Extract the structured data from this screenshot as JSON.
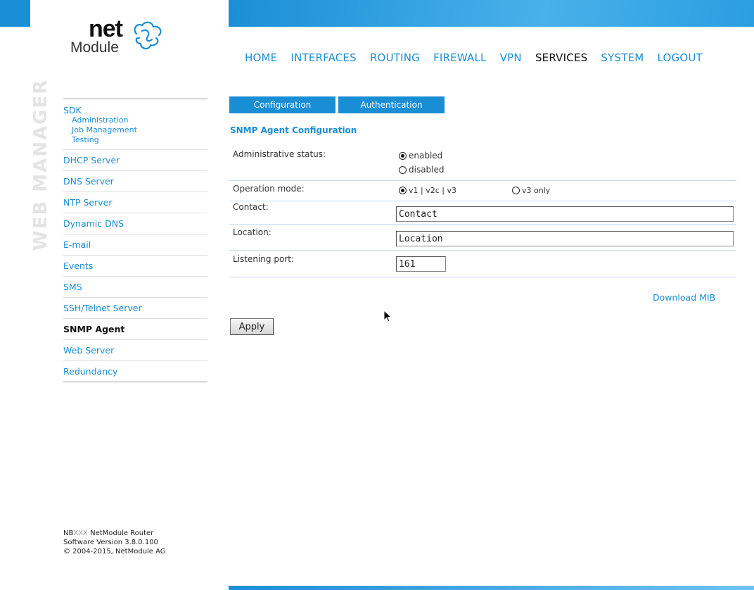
{
  "logo": {
    "net": "net",
    "module": "Module"
  },
  "nav": {
    "items": [
      "HOME",
      "INTERFACES",
      "ROUTING",
      "FIREWALL",
      "VPN",
      "SERVICES",
      "SYSTEM",
      "LOGOUT"
    ],
    "active": "SERVICES"
  },
  "vertical_title": "WEB MANAGER",
  "sidebar": {
    "sdk": {
      "label": "SDK",
      "subitems": [
        "Administration",
        "Job Management",
        "Testing"
      ]
    },
    "items": [
      "DHCP Server",
      "DNS Server",
      "NTP Server",
      "Dynamic DNS",
      "E-mail",
      "Events",
      "SMS",
      "SSH/Telnet Server",
      "SNMP Agent",
      "Web Server",
      "Redundancy"
    ],
    "active": "SNMP Agent"
  },
  "tabs": [
    "Configuration",
    "Authentication"
  ],
  "section_title": "SNMP Agent Configuration",
  "form": {
    "admin_status": {
      "label": "Administrative status:",
      "options": [
        "enabled",
        "disabled"
      ],
      "selected": "enabled"
    },
    "operation_mode": {
      "label": "Operation mode:",
      "options": [
        "v1 | v2c | v3",
        "v3 only"
      ],
      "selected": "v1 | v2c | v3"
    },
    "contact": {
      "label": "Contact:",
      "value": "Contact"
    },
    "location": {
      "label": "Location:",
      "value": "Location"
    },
    "port": {
      "label": "Listening port:",
      "value": "161"
    }
  },
  "download_mib": "Download MIB",
  "apply": "Apply",
  "footer": {
    "model_prefix": "NB",
    "model_dim": "XXX",
    "model_suffix": " NetModule Router",
    "version": "Software Version 3.8.0.100",
    "copyright": "© 2004-2015, NetModule AG"
  },
  "colors": {
    "accent": "#1a8ed5",
    "vertical_text": "#e4e4e4"
  }
}
